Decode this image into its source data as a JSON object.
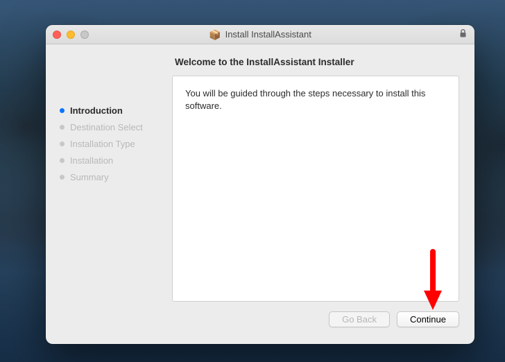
{
  "window": {
    "title": "Install InstallAssistant"
  },
  "sidebar": {
    "steps": [
      {
        "label": "Introduction",
        "active": true
      },
      {
        "label": "Destination Select",
        "active": false
      },
      {
        "label": "Installation Type",
        "active": false
      },
      {
        "label": "Installation",
        "active": false
      },
      {
        "label": "Summary",
        "active": false
      }
    ]
  },
  "main": {
    "heading": "Welcome to the InstallAssistant Installer",
    "body_text": "You will be guided through the steps necessary to install this software."
  },
  "buttons": {
    "go_back": "Go Back",
    "continue": "Continue"
  }
}
